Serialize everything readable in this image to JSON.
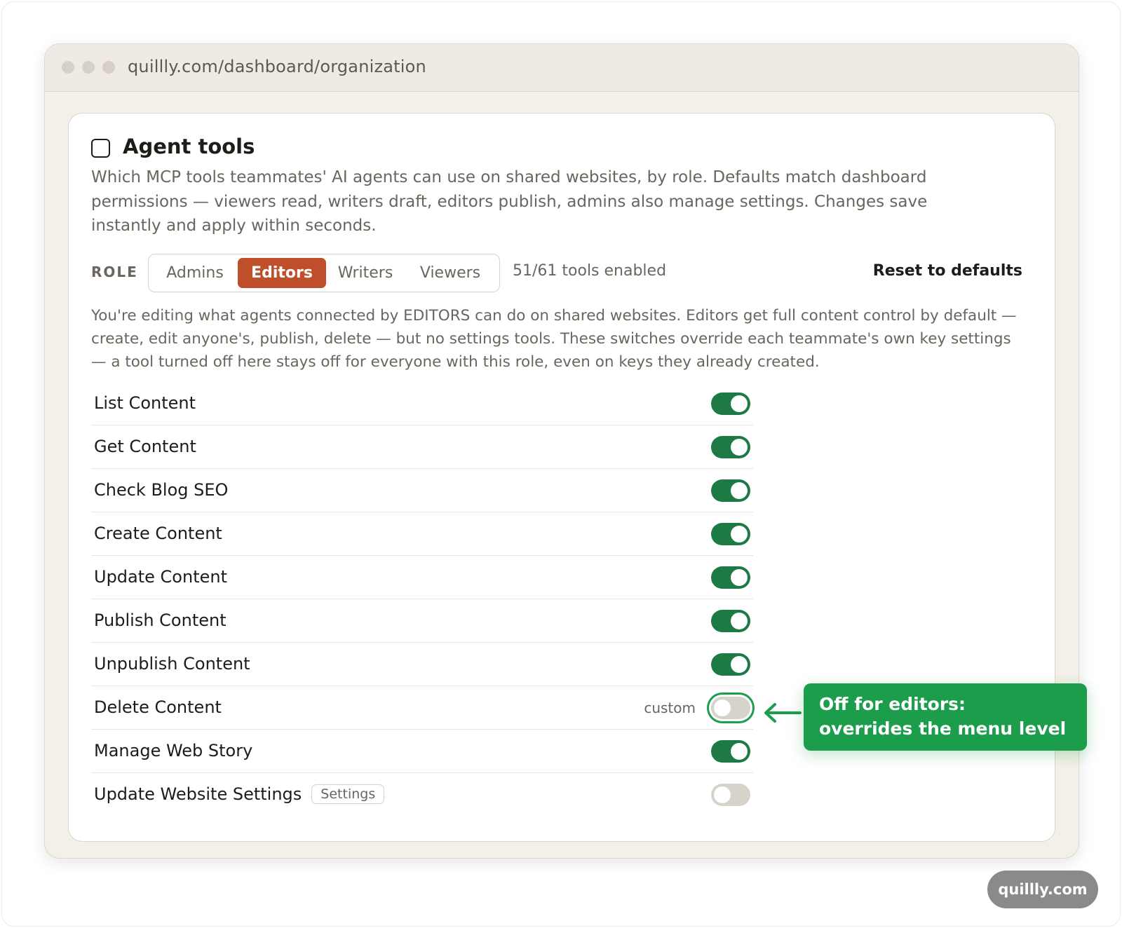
{
  "browser": {
    "url": "quillly.com/dashboard/organization"
  },
  "card": {
    "title": "Agent tools",
    "description": "Which MCP tools teammates' AI agents can use on shared websites, by role. Defaults match dashboard permissions — viewers read, writers draft, editors publish, admins also manage settings. Changes save instantly and apply within seconds."
  },
  "role": {
    "label": "ROLE",
    "options": [
      "Admins",
      "Editors",
      "Writers",
      "Viewers"
    ],
    "selected": "Editors",
    "count_text": "51/61 tools enabled",
    "reset_label": "Reset to defaults"
  },
  "note": "You're editing what agents connected by EDITORS can do on shared websites. Editors get full content control by default — create, edit anyone's, publish, delete — but no settings tools. These switches override each teammate's own key settings — a tool turned off here stays off for everyone with this role, even on keys they already created.",
  "tools": [
    {
      "label": "List Content",
      "enabled": true
    },
    {
      "label": "Get Content",
      "enabled": true
    },
    {
      "label": "Check Blog SEO",
      "enabled": true
    },
    {
      "label": "Create Content",
      "enabled": true
    },
    {
      "label": "Update Content",
      "enabled": true
    },
    {
      "label": "Publish Content",
      "enabled": true
    },
    {
      "label": "Unpublish Content",
      "enabled": true
    },
    {
      "label": "Delete Content",
      "enabled": false,
      "tag": "custom"
    },
    {
      "label": "Manage Web Story",
      "enabled": true
    },
    {
      "label": "Update Website Settings",
      "enabled": false,
      "badge": "Settings"
    }
  ],
  "callout": {
    "line1": "Off for editors:",
    "line2": "overrides the menu level"
  },
  "footer": {
    "brand": "quillly.com"
  },
  "colors": {
    "accent": "#bf4e2b",
    "toggle_on": "#1e7a45",
    "toggle_off": "#d8d3ca",
    "callout": "#1c9d4c"
  },
  "icons": [
    "checkbox-icon",
    "arrow-left-icon"
  ]
}
